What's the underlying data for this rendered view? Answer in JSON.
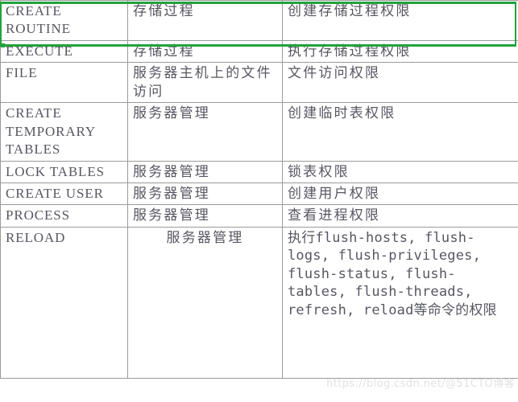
{
  "table": {
    "columns": [
      "privilege",
      "scope",
      "description"
    ],
    "rows": [
      {
        "privilege": "CREATE\nROUTINE",
        "scope": "存储过程",
        "description": "创建存储过程权限",
        "selected": true
      },
      {
        "privilege": "EXECUTE",
        "scope": "存储过程",
        "description": "执行存储过程权限",
        "selected": false
      },
      {
        "privilege": "FILE",
        "scope": "服务器主机上的文件访问",
        "description": "文件访问权限",
        "selected": false
      },
      {
        "privilege": "CREATE\nTEMPORARY\nTABLES",
        "scope": "服务器管理",
        "description": "创建临时表权限",
        "selected": false
      },
      {
        "privilege": "LOCK TABLES",
        "scope": "服务器管理",
        "description": "锁表权限",
        "selected": false
      },
      {
        "privilege": "CREATE USER",
        "scope": "服务器管理",
        "description": "创建用户权限",
        "selected": false
      },
      {
        "privilege": "PROCESS",
        "scope": "服务器管理",
        "description": "查看进程权限",
        "selected": false
      },
      {
        "privilege": "RELOAD",
        "scope": "服务器管理",
        "description": "执行flush-hosts, flush-logs, flush-privileges, flush-status, flush-tables, flush-threads, refresh, reload等命令的权限",
        "selected": false
      }
    ]
  },
  "selection": {
    "highlight_color": "#22a33c",
    "fill_color": "#d7d7d7"
  },
  "watermark": {
    "text": "https://blog.csdn.net/@51CTO博客",
    "color": "#e2e2e2"
  }
}
